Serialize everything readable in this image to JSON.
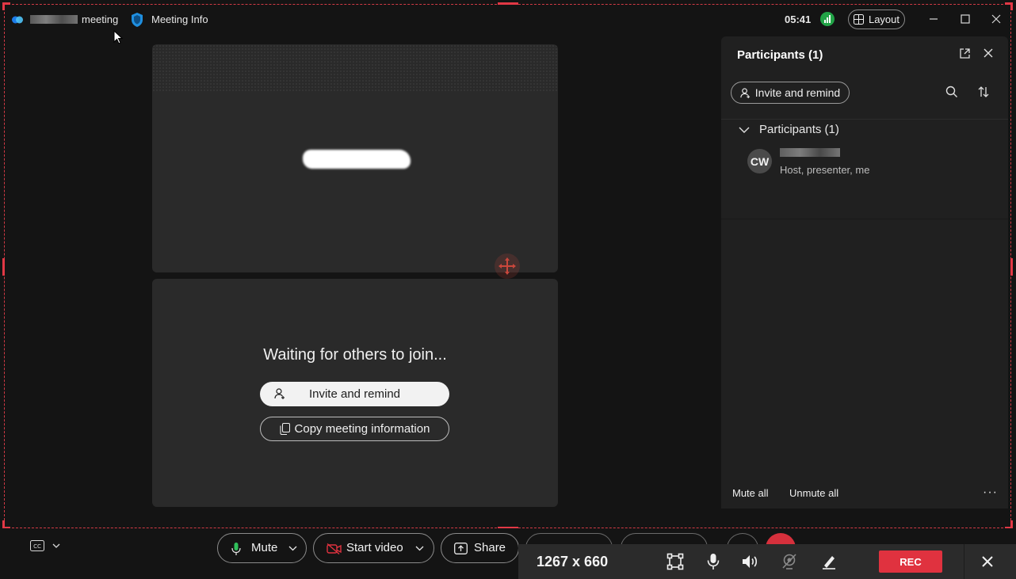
{
  "titlebar": {
    "meeting_title": "meeting",
    "meeting_info_label": "Meeting Info",
    "time": "05:41",
    "layout_label": "Layout"
  },
  "main": {
    "waiting_text": "Waiting for others to join...",
    "invite_button": "Invite and remind",
    "copy_button": "Copy meeting information"
  },
  "participants_panel": {
    "title": "Participants (1)",
    "invite_button": "Invite and remind",
    "group_label": "Participants (1)",
    "participant": {
      "initials": "CW",
      "role": "Host, presenter, me"
    },
    "mute_all": "Mute all",
    "unmute_all": "Unmute all",
    "more": "···"
  },
  "controls": {
    "mute_label": "Mute",
    "start_video_label": "Start video",
    "share_label": "Share"
  },
  "recorder": {
    "size_text": "1267 x 660",
    "rec_label": "REC"
  },
  "colors": {
    "accent_red": "#e0323f",
    "signal_green": "#22a447",
    "frame_dash": "#d23a45"
  }
}
